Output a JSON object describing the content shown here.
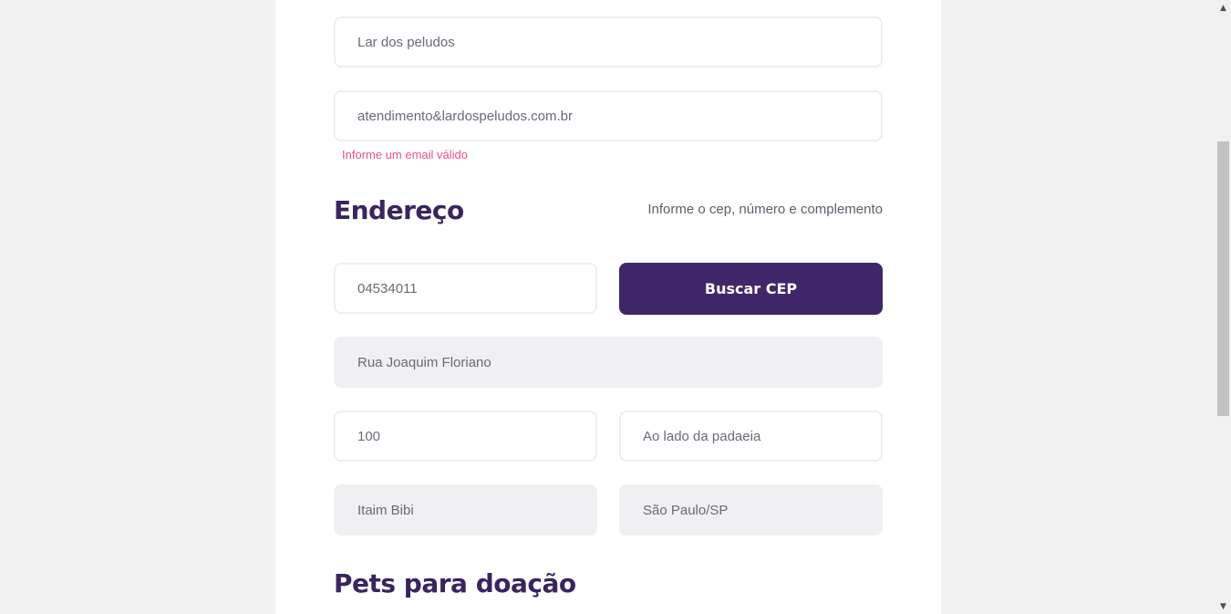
{
  "form": {
    "name_value": "Lar dos peludos",
    "email_value": "atendimento&lardospeludos.com.br",
    "email_error": "Informe um email válido"
  },
  "address": {
    "title": "Endereço",
    "hint": "Informe o cep, número e complemento",
    "cep_value": "04534011",
    "search_cep_label": "Buscar CEP",
    "street_value": "Rua Joaquim Floriano",
    "number_value": "100",
    "complement_value": "Ao lado da padaeia",
    "neighborhood_value": "Itaim Bibi",
    "city_value": "São Paulo/SP"
  },
  "pets": {
    "title": "Pets para doação"
  },
  "scrollbar": {
    "up_icon": "▲",
    "down_icon": "▼"
  },
  "colors": {
    "primary": "#3f2769",
    "title": "#3a2460",
    "error": "#e8508a",
    "disabled_field": "#f0f0f3"
  }
}
